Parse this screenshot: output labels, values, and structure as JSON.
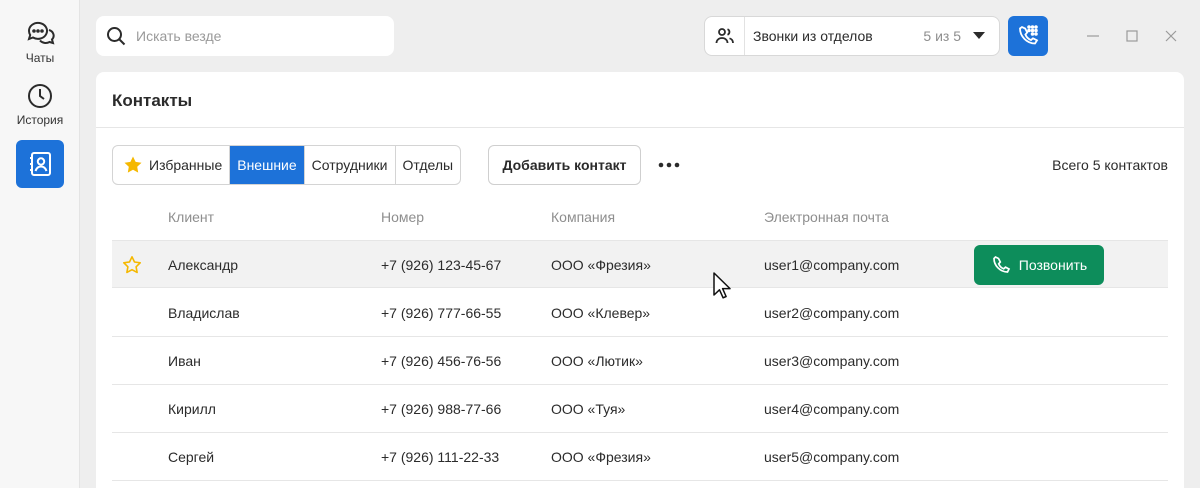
{
  "sidebar": {
    "items": [
      {
        "label": "Чаты",
        "icon": "chats-icon"
      },
      {
        "label": "История",
        "icon": "history-icon"
      },
      {
        "label": "",
        "icon": "contacts-icon",
        "active": true
      }
    ]
  },
  "search": {
    "placeholder": "Искать везде",
    "value": ""
  },
  "dept_select": {
    "label": "Звонки из отделов",
    "count": "5 из 5"
  },
  "colors": {
    "accent": "#1d72d9",
    "call": "#0d8d5b",
    "star": "#f5b800"
  },
  "panel": {
    "title": "Контакты",
    "tabs": [
      {
        "label": "Избранные",
        "active": false
      },
      {
        "label": "Внешние",
        "active": true
      },
      {
        "label": "Сотрудники",
        "active": false
      },
      {
        "label": "Отделы",
        "active": false
      }
    ],
    "add_contact_label": "Добавить контакт",
    "total_label": "Всего 5 контактов"
  },
  "table": {
    "columns": [
      "Клиент",
      "Номер",
      "Компания",
      "Электронная почта"
    ],
    "rows": [
      {
        "name": "Александр",
        "phone": "+7 (926) 123-45-67",
        "company": "ООО «Фрезия»",
        "email": "user1@company.com"
      },
      {
        "name": "Владислав",
        "phone": "+7 (926) 777-66-55",
        "company": "ООО «Клевер»",
        "email": "user2@company.com"
      },
      {
        "name": "Иван",
        "phone": "+7 (926) 456-76-56",
        "company": "ООО «Лютик»",
        "email": "user3@company.com"
      },
      {
        "name": "Кирилл",
        "phone": "+7 (926) 988-77-66",
        "company": "ООО «Туя»",
        "email": "user4@company.com"
      },
      {
        "name": "Сергей",
        "phone": "+7 (926) 111-22-33",
        "company": "ООО «Фрезия»",
        "email": "user5@company.com"
      }
    ],
    "call_label": "Позвонить"
  }
}
